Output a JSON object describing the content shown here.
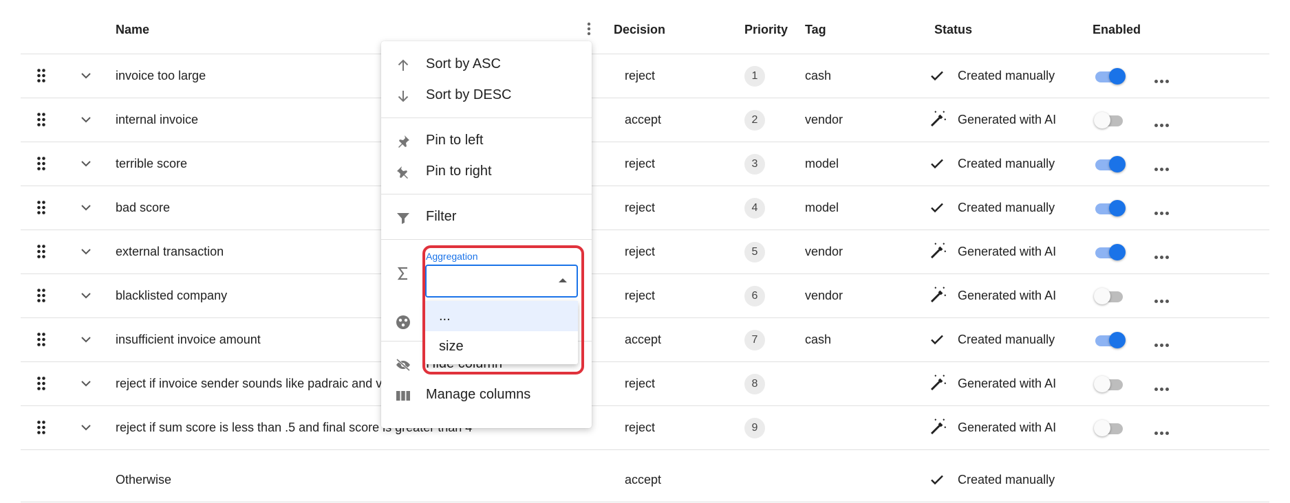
{
  "header": {
    "name": "Name",
    "decision": "Decision",
    "priority": "Priority",
    "tag": "Tag",
    "status": "Status",
    "enabled": "Enabled"
  },
  "rows": [
    {
      "name": "invoice too large",
      "decision": "reject",
      "priority": "1",
      "tag": "cash",
      "status": "Created manually",
      "status_icon": "check-icon",
      "enabled": true
    },
    {
      "name": "internal invoice",
      "decision": "accept",
      "priority": "2",
      "tag": "vendor",
      "status": "Generated with AI",
      "status_icon": "magic-wand-icon",
      "enabled": false
    },
    {
      "name": "terrible score",
      "decision": "reject",
      "priority": "3",
      "tag": "model",
      "status": "Created manually",
      "status_icon": "check-icon",
      "enabled": true
    },
    {
      "name": "bad score",
      "decision": "reject",
      "priority": "4",
      "tag": "model",
      "status": "Created manually",
      "status_icon": "check-icon",
      "enabled": true
    },
    {
      "name": "external transaction",
      "decision": "reject",
      "priority": "5",
      "tag": "vendor",
      "status": "Generated with AI",
      "status_icon": "magic-wand-icon",
      "enabled": true
    },
    {
      "name": "blacklisted company",
      "decision": "reject",
      "priority": "6",
      "tag": "vendor",
      "status": "Generated with AI",
      "status_icon": "magic-wand-icon",
      "enabled": false
    },
    {
      "name": "insufficient invoice amount",
      "decision": "accept",
      "priority": "7",
      "tag": "cash",
      "status": "Created manually",
      "status_icon": "check-icon",
      "enabled": true
    },
    {
      "name": "reject if invoice sender sounds like padraic and ve",
      "decision": "reject",
      "priority": "8",
      "tag": "",
      "status": "Generated with AI",
      "status_icon": "magic-wand-icon",
      "enabled": false
    },
    {
      "name": "reject if sum score is less than .5 and final score is greater than 4",
      "decision": "reject",
      "priority": "9",
      "tag": "",
      "status": "Generated with AI",
      "status_icon": "magic-wand-icon",
      "enabled": false
    }
  ],
  "footer_row": {
    "name": "Otherwise",
    "decision": "accept",
    "status": "Created manually",
    "status_icon": "check-icon"
  },
  "column_menu": {
    "sort_asc": "Sort by ASC",
    "sort_desc": "Sort by DESC",
    "pin_left": "Pin to left",
    "pin_right": "Pin to right",
    "filter": "Filter",
    "aggregation_label": "Aggregation",
    "aggregation_value": "",
    "aggregation_options": [
      "...",
      "size"
    ],
    "hide_column": "Hide column",
    "manage_columns": "Manage columns"
  },
  "colors": {
    "accent": "#1a73e8",
    "highlight": "#e0323c"
  }
}
